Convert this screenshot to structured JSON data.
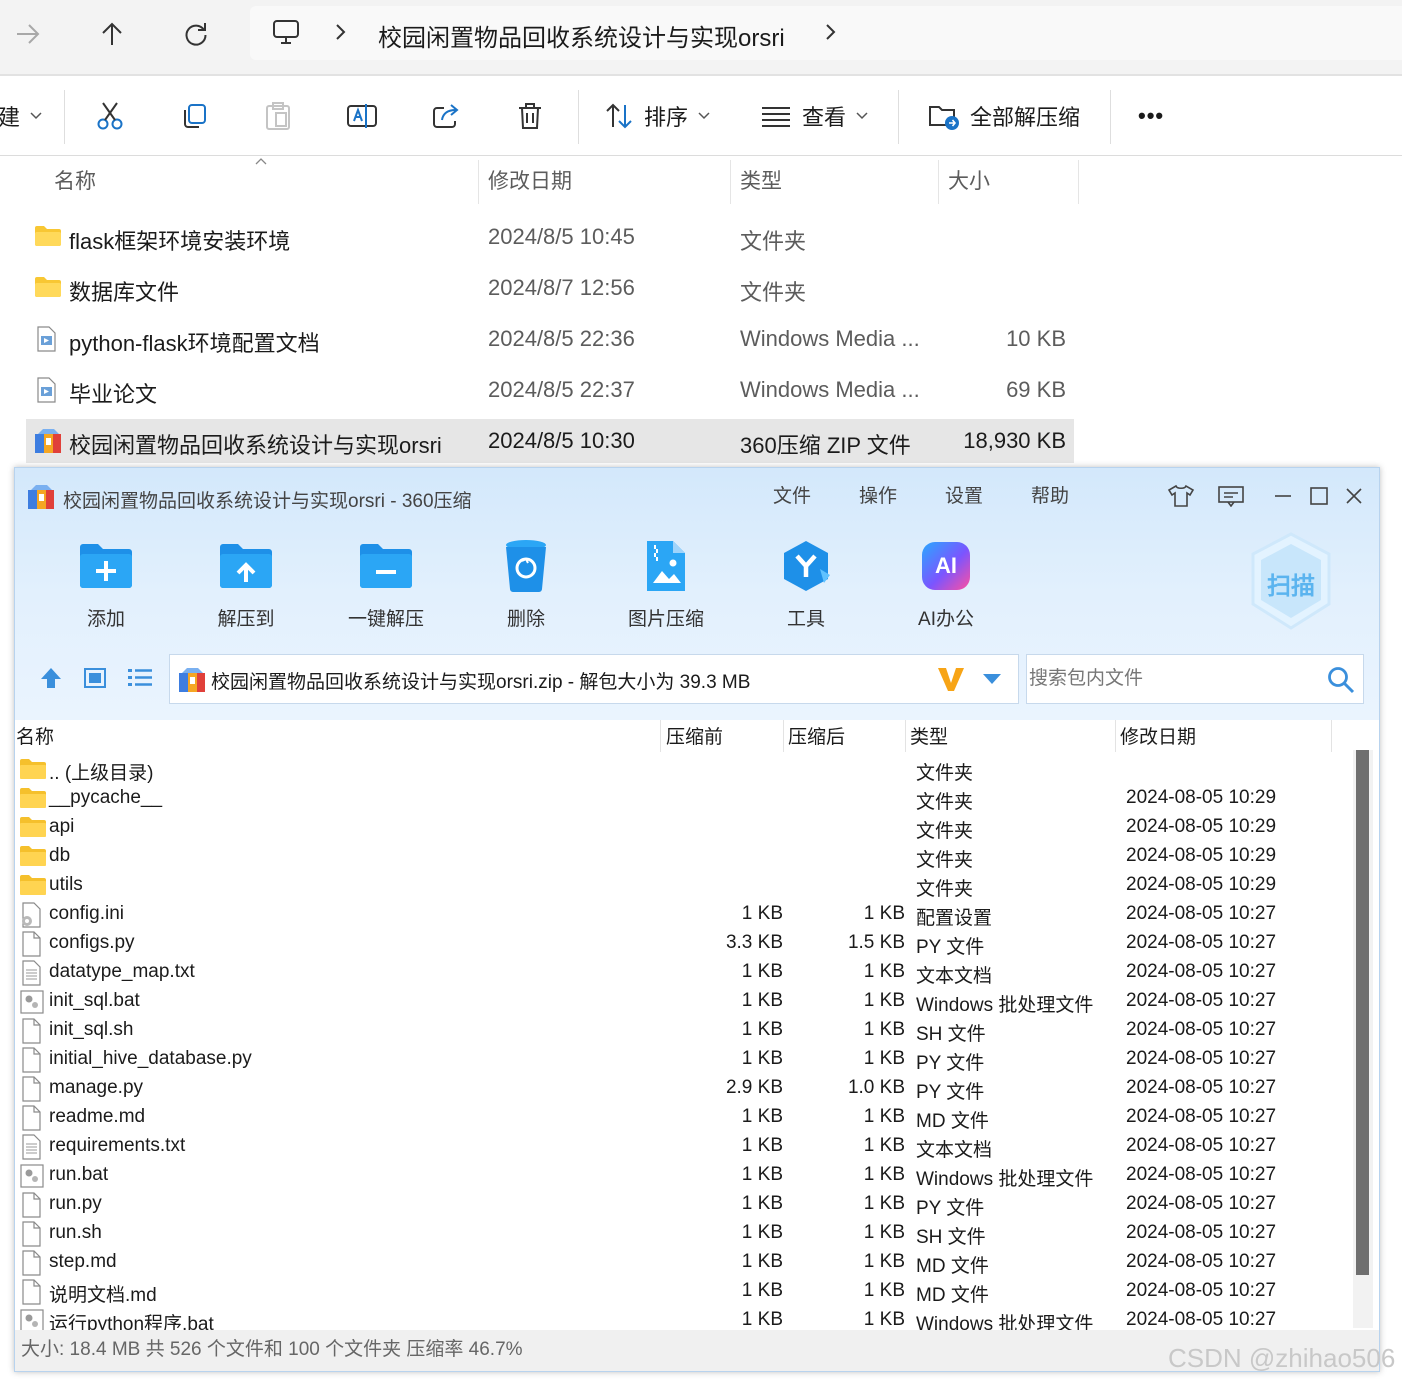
{
  "explorer": {
    "address": {
      "crumb": "校园闲置物品回收系统设计与实现orsri"
    },
    "toolbar": {
      "new_partial": "建",
      "sort_label": "排序",
      "view_label": "查看",
      "extract_all_label": "全部解压缩",
      "more_label": "•••"
    },
    "columns": {
      "name": "名称",
      "date": "修改日期",
      "type": "类型",
      "size": "大小"
    },
    "files": [
      {
        "name": "flask框架环境安装环境",
        "date": "2024/8/5 10:45",
        "type": "文件夹",
        "size": ""
      },
      {
        "name": "数据库文件",
        "date": "2024/8/7 12:56",
        "type": "文件夹",
        "size": ""
      },
      {
        "name": "python-flask环境配置文档",
        "date": "2024/8/5 22:36",
        "type": "Windows Media ...",
        "size": "10 KB"
      },
      {
        "name": "毕业论文",
        "date": "2024/8/5 22:37",
        "type": "Windows Media ...",
        "size": "69 KB"
      },
      {
        "name": "校园闲置物品回收系统设计与实现orsri",
        "date": "2024/8/5 10:30",
        "type": "360压缩 ZIP 文件",
        "size": "18,930 KB"
      }
    ]
  },
  "zip": {
    "title": "校园闲置物品回收系统设计与实现orsri - 360压缩",
    "menu": [
      "文件",
      "操作",
      "设置",
      "帮助"
    ],
    "actions": [
      "添加",
      "解压到",
      "一键解压",
      "删除",
      "图片压缩",
      "工具",
      "AI办公"
    ],
    "ai_badge": "AI",
    "scan_label": "扫描",
    "path": "校园闲置物品回收系统设计与实现orsri.zip - 解包大小为 39.3 MB",
    "search_placeholder": "搜索包内文件",
    "columns": {
      "name": "名称",
      "before": "压缩前",
      "after": "压缩后",
      "type": "类型",
      "date": "修改日期"
    },
    "rows": [
      {
        "name": ".. (上级目录)",
        "before": "",
        "after": "",
        "type": "文件夹",
        "date": ""
      },
      {
        "name": "__pycache__",
        "before": "",
        "after": "",
        "type": "文件夹",
        "date": "2024-08-05 10:29"
      },
      {
        "name": "api",
        "before": "",
        "after": "",
        "type": "文件夹",
        "date": "2024-08-05 10:29"
      },
      {
        "name": "db",
        "before": "",
        "after": "",
        "type": "文件夹",
        "date": "2024-08-05 10:29"
      },
      {
        "name": "utils",
        "before": "",
        "after": "",
        "type": "文件夹",
        "date": "2024-08-05 10:29"
      },
      {
        "name": "config.ini",
        "before": "1 KB",
        "after": "1 KB",
        "type": "配置设置",
        "date": "2024-08-05 10:27"
      },
      {
        "name": "configs.py",
        "before": "3.3 KB",
        "after": "1.5 KB",
        "type": "PY 文件",
        "date": "2024-08-05 10:27"
      },
      {
        "name": "datatype_map.txt",
        "before": "1 KB",
        "after": "1 KB",
        "type": "文本文档",
        "date": "2024-08-05 10:27"
      },
      {
        "name": "init_sql.bat",
        "before": "1 KB",
        "after": "1 KB",
        "type": "Windows 批处理文件",
        "date": "2024-08-05 10:27"
      },
      {
        "name": "init_sql.sh",
        "before": "1 KB",
        "after": "1 KB",
        "type": "SH 文件",
        "date": "2024-08-05 10:27"
      },
      {
        "name": "initial_hive_database.py",
        "before": "1 KB",
        "after": "1 KB",
        "type": "PY 文件",
        "date": "2024-08-05 10:27"
      },
      {
        "name": "manage.py",
        "before": "2.9 KB",
        "after": "1.0 KB",
        "type": "PY 文件",
        "date": "2024-08-05 10:27"
      },
      {
        "name": "readme.md",
        "before": "1 KB",
        "after": "1 KB",
        "type": "MD 文件",
        "date": "2024-08-05 10:27"
      },
      {
        "name": "requirements.txt",
        "before": "1 KB",
        "after": "1 KB",
        "type": "文本文档",
        "date": "2024-08-05 10:27"
      },
      {
        "name": "run.bat",
        "before": "1 KB",
        "after": "1 KB",
        "type": "Windows 批处理文件",
        "date": "2024-08-05 10:27"
      },
      {
        "name": "run.py",
        "before": "1 KB",
        "after": "1 KB",
        "type": "PY 文件",
        "date": "2024-08-05 10:27"
      },
      {
        "name": "run.sh",
        "before": "1 KB",
        "after": "1 KB",
        "type": "SH 文件",
        "date": "2024-08-05 10:27"
      },
      {
        "name": "step.md",
        "before": "1 KB",
        "after": "1 KB",
        "type": "MD 文件",
        "date": "2024-08-05 10:27"
      },
      {
        "name": "说明文档.md",
        "before": "1 KB",
        "after": "1 KB",
        "type": "MD 文件",
        "date": "2024-08-05 10:27"
      },
      {
        "name": "运行python程序.bat",
        "before": "1 KB",
        "after": "1 KB",
        "type": "Windows 批处理文件",
        "date": "2024-08-05 10:27"
      }
    ],
    "status": "大小: 18.4 MB 共 526 个文件和 100 个文件夹 压缩率 46.7%"
  },
  "watermark": "CSDN @zhihao506"
}
